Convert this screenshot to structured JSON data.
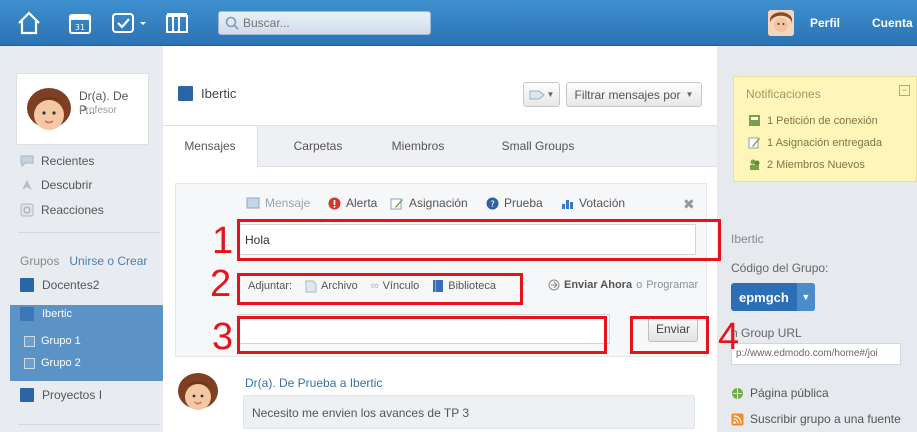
{
  "topbar": {
    "calendar_day": "31",
    "search_placeholder": "Buscar...",
    "profile_label": "Perfil",
    "account_label": "Cuenta"
  },
  "sidebar": {
    "user_name": "Dr(a). De P...",
    "user_role": "Profesor",
    "nav": [
      "Recientes",
      "Descubrir",
      "Reacciones"
    ],
    "groups_label": "Grupos",
    "groups_join": "Unirse o Crear",
    "groups": [
      "Docentes2",
      "Ibertic"
    ],
    "subgroups": [
      "Grupo 1",
      "Grupo 2"
    ],
    "other_group": "Proyectos I"
  },
  "main": {
    "group_title": "Ibertic",
    "filter_label": "Filtrar mensajes por",
    "tabs": [
      "Mensajes",
      "Carpetas",
      "Miembros",
      "Small Groups"
    ],
    "composer": {
      "types": [
        "Mensaje",
        "Alerta",
        "Asignación",
        "Prueba",
        "Votación"
      ],
      "message_value": "Hola",
      "attach_label": "Adjuntar:",
      "attach_links": [
        "Archivo",
        "Vínculo",
        "Biblioteca"
      ],
      "send_now": "Enviar Ahora",
      "or": "o",
      "schedule": "Programar",
      "send_button": "Enviar"
    },
    "post": {
      "author": "Dr(a). De Prueba a Ibertic",
      "body": "Necesito me envien los avances de TP 3"
    }
  },
  "right": {
    "notifications_title": "Notificaciones",
    "notifications": [
      "1 Petición de conexión",
      "1 Asignación entregada",
      "2 Miembros Nuevos"
    ],
    "group_name": "Ibertic",
    "code_label": "Código del Grupo:",
    "code_value": "epmgch",
    "url_label": "n Group URL",
    "url_value": "p://www.edmodo.com/home#/joi",
    "public_page": "Página pública",
    "subscribe": "Suscribir grupo a una fuente"
  },
  "annotations": [
    "1",
    "2",
    "3",
    "4"
  ],
  "colors": {
    "topbar": "#3580c2",
    "accent": "#2a65a5",
    "annotation": "#e5131b",
    "notification_bg": "#fdf6b8"
  }
}
